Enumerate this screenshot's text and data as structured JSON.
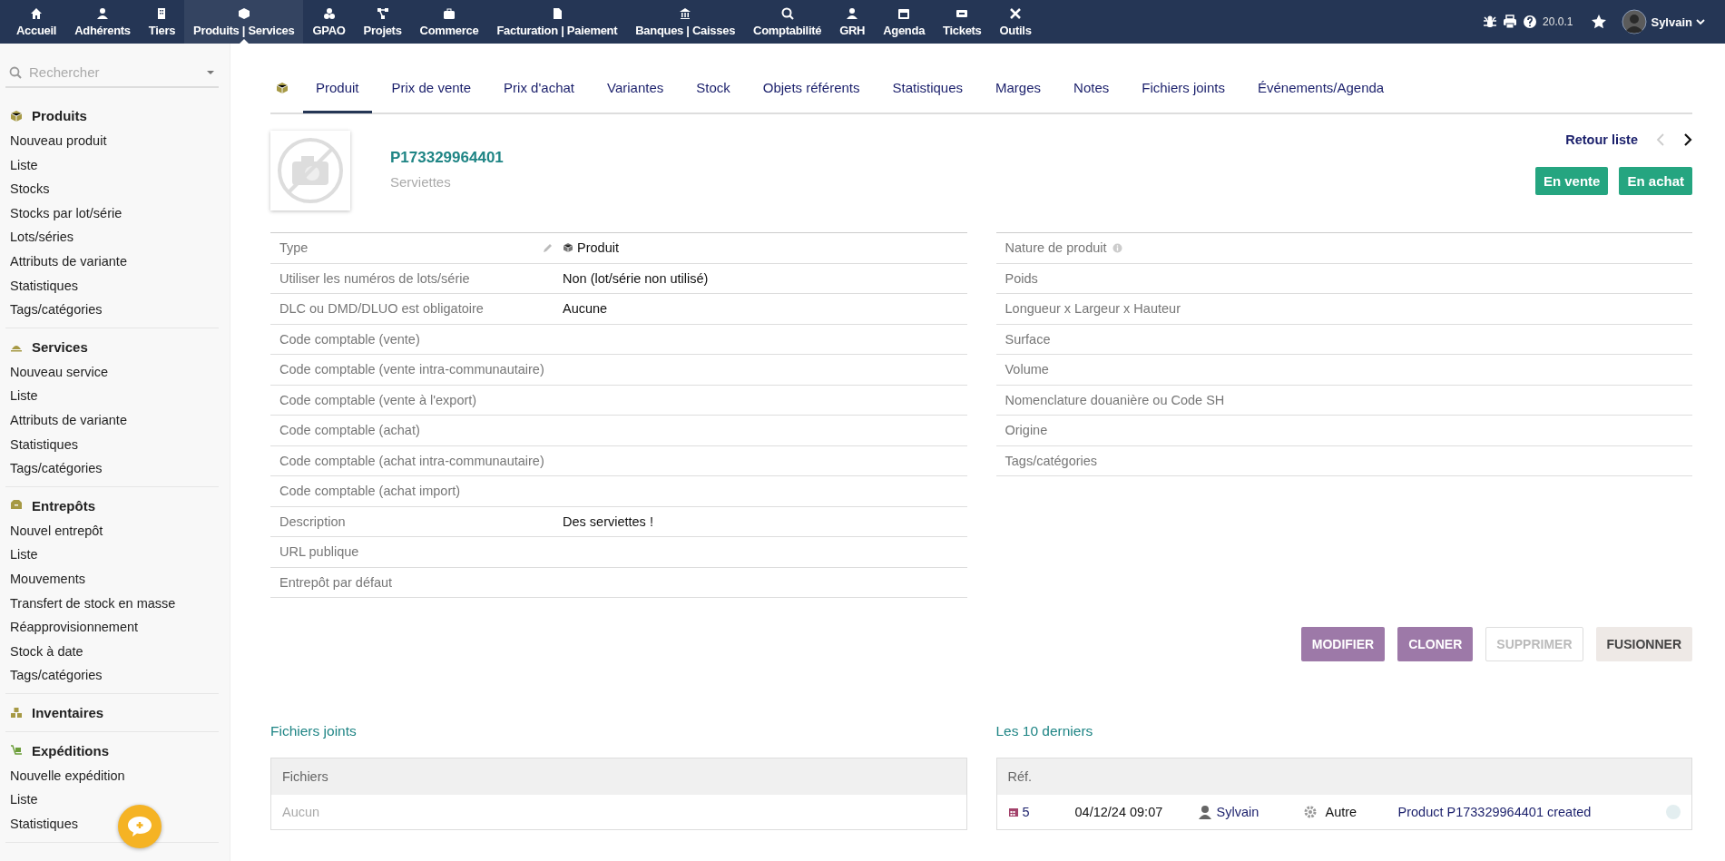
{
  "top_menu": [
    {
      "label": "Accueil",
      "selected": false
    },
    {
      "label": "Adhérents",
      "selected": false
    },
    {
      "label": "Tiers",
      "selected": false
    },
    {
      "label": "Produits | Services",
      "selected": true
    },
    {
      "label": "GPAO",
      "selected": false
    },
    {
      "label": "Projets",
      "selected": false
    },
    {
      "label": "Commerce",
      "selected": false
    },
    {
      "label": "Facturation | Paiement",
      "selected": false
    },
    {
      "label": "Banques | Caisses",
      "selected": false
    },
    {
      "label": "Comptabilité",
      "selected": false
    },
    {
      "label": "GRH",
      "selected": false
    },
    {
      "label": "Agenda",
      "selected": false
    },
    {
      "label": "Tickets",
      "selected": false
    },
    {
      "label": "Outils",
      "selected": false
    }
  ],
  "top_right": {
    "version": "20.0.1",
    "user": "Sylvain"
  },
  "sidebar": {
    "search": {
      "placeholder": "Rechercher"
    },
    "sections": [
      {
        "title": "Produits",
        "items": [
          "Nouveau produit",
          "Liste",
          "Stocks",
          "Stocks par lot/série",
          "Lots/séries",
          "Attributs de variante",
          "Statistiques",
          "Tags/catégories"
        ]
      },
      {
        "title": "Services",
        "items": [
          "Nouveau service",
          "Liste",
          "Attributs de variante",
          "Statistiques",
          "Tags/catégories"
        ]
      },
      {
        "title": "Entrepôts",
        "items": [
          "Nouvel entrepôt",
          "Liste",
          "Mouvements",
          "Transfert de stock en masse",
          "Réapprovisionnement",
          "Stock à date",
          "Tags/catégories"
        ]
      },
      {
        "title": "Inventaires"
      },
      {
        "title": "Expéditions",
        "items": [
          "Nouvelle expédition",
          "Liste",
          "Statistiques"
        ]
      }
    ]
  },
  "tabs": [
    {
      "label": "Produit",
      "selected": true
    },
    {
      "label": "Prix de vente",
      "selected": false
    },
    {
      "label": "Prix d'achat",
      "selected": false
    },
    {
      "label": "Variantes",
      "selected": false
    },
    {
      "label": "Stock",
      "selected": false
    },
    {
      "label": "Objets référents",
      "selected": false
    },
    {
      "label": "Statistiques",
      "selected": false
    },
    {
      "label": "Marges",
      "selected": false
    },
    {
      "label": "Notes",
      "selected": false
    },
    {
      "label": "Fichiers joints",
      "selected": false
    },
    {
      "label": "Événements/Agenda",
      "selected": false
    }
  ],
  "product": {
    "ref": "P173329964401",
    "label": "Serviettes",
    "back_link": "Retour liste",
    "badges": [
      "En vente",
      "En achat"
    ]
  },
  "left_fields": [
    {
      "label": "Type",
      "value": "Produit",
      "kind": "type"
    },
    {
      "label": "Utiliser les numéros de lots/série",
      "value": "Non (lot/série non utilisé)"
    },
    {
      "label": "DLC ou DMD/DLUO est obligatoire",
      "value": "Aucune"
    },
    {
      "label": "Code comptable (vente)"
    },
    {
      "label": "Code comptable (vente intra-communautaire)"
    },
    {
      "label": "Code comptable (vente à l'export)"
    },
    {
      "label": "Code comptable (achat)"
    },
    {
      "label": "Code comptable (achat intra-communautaire)"
    },
    {
      "label": "Code comptable (achat import)"
    },
    {
      "label": "Description",
      "value": "Des serviettes !"
    },
    {
      "label": "URL publique"
    },
    {
      "label": "Entrepôt par défaut"
    }
  ],
  "right_fields": [
    {
      "label": "Nature de produit",
      "kind": "info"
    },
    {
      "label": "Poids"
    },
    {
      "label": "Longueur x Largeur x Hauteur"
    },
    {
      "label": "Surface"
    },
    {
      "label": "Volume"
    },
    {
      "label": "Nomenclature douanière ou Code SH"
    },
    {
      "label": "Origine"
    },
    {
      "label": "Tags/catégories"
    }
  ],
  "actions": [
    {
      "label": "MODIFIER",
      "disabled": false,
      "kind": "primary"
    },
    {
      "label": "CLONER",
      "disabled": false,
      "kind": "primary"
    },
    {
      "label": "SUPPRIMER",
      "disabled": true,
      "kind": "danger"
    },
    {
      "label": "FUSIONNER",
      "disabled": false,
      "kind": "secondary"
    }
  ],
  "files": {
    "title": "Fichiers joints",
    "column": "Fichiers",
    "empty": "Aucun"
  },
  "events": {
    "title": "Les 10 derniers",
    "columns": [
      "Réf."
    ],
    "rows": [
      {
        "ref": "5",
        "date": "04/12/24 09:07",
        "user": "Sylvain",
        "type": "Autre",
        "label": "Product P173329964401 created"
      }
    ]
  }
}
